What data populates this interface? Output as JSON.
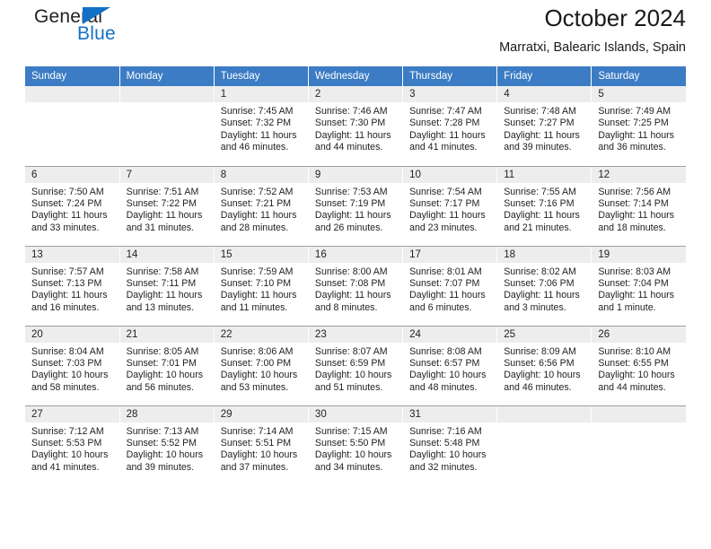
{
  "brand": {
    "line1": "General",
    "line2": "Blue",
    "triangle_color": "#1271c4"
  },
  "header": {
    "title": "October 2024",
    "subtitle": "Marratxi, Balearic Islands, Spain"
  },
  "theme": {
    "header_blue": "#3b7cc4",
    "daynum_background": "#ededed",
    "grid_line": "#9aa0a6",
    "text": "#222222"
  },
  "calendar": {
    "weekday_headers": [
      "Sunday",
      "Monday",
      "Tuesday",
      "Wednesday",
      "Thursday",
      "Friday",
      "Saturday"
    ],
    "weeks": [
      [
        {
          "day": "",
          "lines": []
        },
        {
          "day": "",
          "lines": []
        },
        {
          "day": "1",
          "lines": [
            "Sunrise: 7:45 AM",
            "Sunset: 7:32 PM",
            "Daylight: 11 hours",
            "and 46 minutes."
          ]
        },
        {
          "day": "2",
          "lines": [
            "Sunrise: 7:46 AM",
            "Sunset: 7:30 PM",
            "Daylight: 11 hours",
            "and 44 minutes."
          ]
        },
        {
          "day": "3",
          "lines": [
            "Sunrise: 7:47 AM",
            "Sunset: 7:28 PM",
            "Daylight: 11 hours",
            "and 41 minutes."
          ]
        },
        {
          "day": "4",
          "lines": [
            "Sunrise: 7:48 AM",
            "Sunset: 7:27 PM",
            "Daylight: 11 hours",
            "and 39 minutes."
          ]
        },
        {
          "day": "5",
          "lines": [
            "Sunrise: 7:49 AM",
            "Sunset: 7:25 PM",
            "Daylight: 11 hours",
            "and 36 minutes."
          ]
        }
      ],
      [
        {
          "day": "6",
          "lines": [
            "Sunrise: 7:50 AM",
            "Sunset: 7:24 PM",
            "Daylight: 11 hours",
            "and 33 minutes."
          ]
        },
        {
          "day": "7",
          "lines": [
            "Sunrise: 7:51 AM",
            "Sunset: 7:22 PM",
            "Daylight: 11 hours",
            "and 31 minutes."
          ]
        },
        {
          "day": "8",
          "lines": [
            "Sunrise: 7:52 AM",
            "Sunset: 7:21 PM",
            "Daylight: 11 hours",
            "and 28 minutes."
          ]
        },
        {
          "day": "9",
          "lines": [
            "Sunrise: 7:53 AM",
            "Sunset: 7:19 PM",
            "Daylight: 11 hours",
            "and 26 minutes."
          ]
        },
        {
          "day": "10",
          "lines": [
            "Sunrise: 7:54 AM",
            "Sunset: 7:17 PM",
            "Daylight: 11 hours",
            "and 23 minutes."
          ]
        },
        {
          "day": "11",
          "lines": [
            "Sunrise: 7:55 AM",
            "Sunset: 7:16 PM",
            "Daylight: 11 hours",
            "and 21 minutes."
          ]
        },
        {
          "day": "12",
          "lines": [
            "Sunrise: 7:56 AM",
            "Sunset: 7:14 PM",
            "Daylight: 11 hours",
            "and 18 minutes."
          ]
        }
      ],
      [
        {
          "day": "13",
          "lines": [
            "Sunrise: 7:57 AM",
            "Sunset: 7:13 PM",
            "Daylight: 11 hours",
            "and 16 minutes."
          ]
        },
        {
          "day": "14",
          "lines": [
            "Sunrise: 7:58 AM",
            "Sunset: 7:11 PM",
            "Daylight: 11 hours",
            "and 13 minutes."
          ]
        },
        {
          "day": "15",
          "lines": [
            "Sunrise: 7:59 AM",
            "Sunset: 7:10 PM",
            "Daylight: 11 hours",
            "and 11 minutes."
          ]
        },
        {
          "day": "16",
          "lines": [
            "Sunrise: 8:00 AM",
            "Sunset: 7:08 PM",
            "Daylight: 11 hours",
            "and 8 minutes."
          ]
        },
        {
          "day": "17",
          "lines": [
            "Sunrise: 8:01 AM",
            "Sunset: 7:07 PM",
            "Daylight: 11 hours",
            "and 6 minutes."
          ]
        },
        {
          "day": "18",
          "lines": [
            "Sunrise: 8:02 AM",
            "Sunset: 7:06 PM",
            "Daylight: 11 hours",
            "and 3 minutes."
          ]
        },
        {
          "day": "19",
          "lines": [
            "Sunrise: 8:03 AM",
            "Sunset: 7:04 PM",
            "Daylight: 11 hours",
            "and 1 minute."
          ]
        }
      ],
      [
        {
          "day": "20",
          "lines": [
            "Sunrise: 8:04 AM",
            "Sunset: 7:03 PM",
            "Daylight: 10 hours",
            "and 58 minutes."
          ]
        },
        {
          "day": "21",
          "lines": [
            "Sunrise: 8:05 AM",
            "Sunset: 7:01 PM",
            "Daylight: 10 hours",
            "and 56 minutes."
          ]
        },
        {
          "day": "22",
          "lines": [
            "Sunrise: 8:06 AM",
            "Sunset: 7:00 PM",
            "Daylight: 10 hours",
            "and 53 minutes."
          ]
        },
        {
          "day": "23",
          "lines": [
            "Sunrise: 8:07 AM",
            "Sunset: 6:59 PM",
            "Daylight: 10 hours",
            "and 51 minutes."
          ]
        },
        {
          "day": "24",
          "lines": [
            "Sunrise: 8:08 AM",
            "Sunset: 6:57 PM",
            "Daylight: 10 hours",
            "and 48 minutes."
          ]
        },
        {
          "day": "25",
          "lines": [
            "Sunrise: 8:09 AM",
            "Sunset: 6:56 PM",
            "Daylight: 10 hours",
            "and 46 minutes."
          ]
        },
        {
          "day": "26",
          "lines": [
            "Sunrise: 8:10 AM",
            "Sunset: 6:55 PM",
            "Daylight: 10 hours",
            "and 44 minutes."
          ]
        }
      ],
      [
        {
          "day": "27",
          "lines": [
            "Sunrise: 7:12 AM",
            "Sunset: 5:53 PM",
            "Daylight: 10 hours",
            "and 41 minutes."
          ]
        },
        {
          "day": "28",
          "lines": [
            "Sunrise: 7:13 AM",
            "Sunset: 5:52 PM",
            "Daylight: 10 hours",
            "and 39 minutes."
          ]
        },
        {
          "day": "29",
          "lines": [
            "Sunrise: 7:14 AM",
            "Sunset: 5:51 PM",
            "Daylight: 10 hours",
            "and 37 minutes."
          ]
        },
        {
          "day": "30",
          "lines": [
            "Sunrise: 7:15 AM",
            "Sunset: 5:50 PM",
            "Daylight: 10 hours",
            "and 34 minutes."
          ]
        },
        {
          "day": "31",
          "lines": [
            "Sunrise: 7:16 AM",
            "Sunset: 5:48 PM",
            "Daylight: 10 hours",
            "and 32 minutes."
          ]
        },
        {
          "day": "",
          "lines": []
        },
        {
          "day": "",
          "lines": []
        }
      ]
    ]
  }
}
